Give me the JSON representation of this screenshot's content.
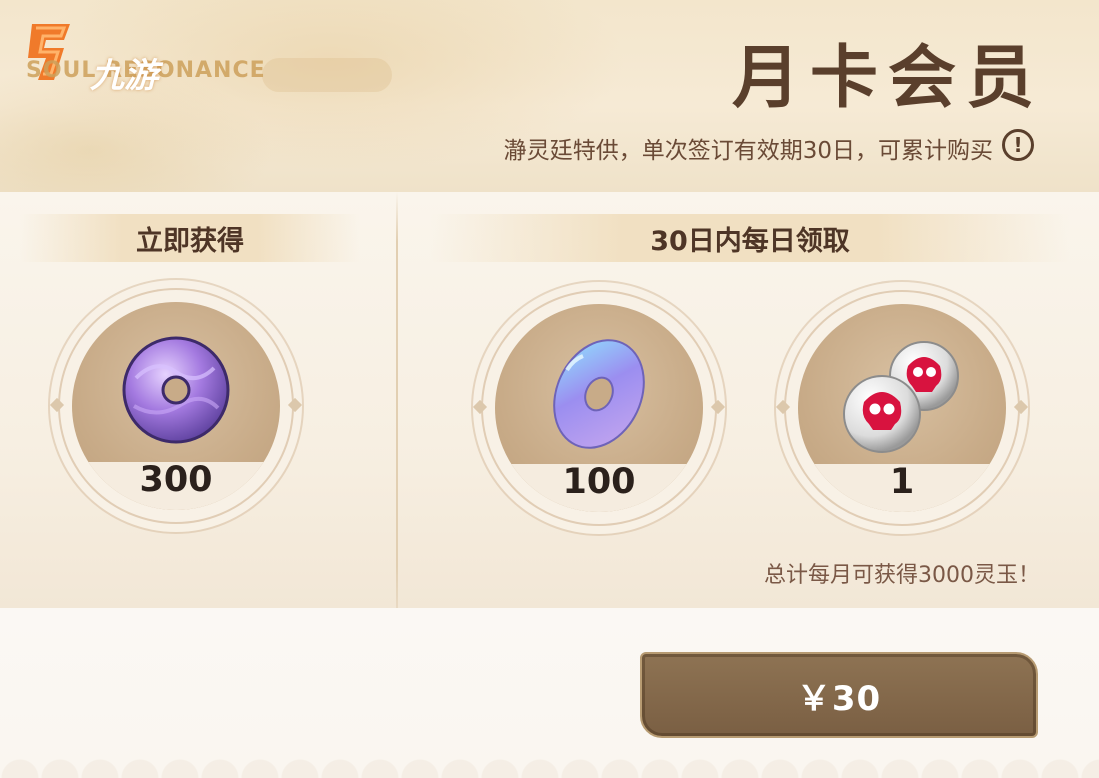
{
  "header": {
    "logo_game_name": "SOUL RESONANCE",
    "logo_watermark": "九游",
    "title": "月卡会员",
    "subtitle": "瀞灵廷特供，单次签订有效期30日，可累计购买",
    "info_icon": "info-exclamation-icon"
  },
  "left_section": {
    "heading": "立即获得",
    "items": [
      {
        "name": "灵玉",
        "icon": "purple-jade-coin-icon",
        "quantity": "300"
      }
    ]
  },
  "right_section": {
    "heading": "30日内每日领取",
    "items": [
      {
        "name": "灵玉",
        "icon": "blue-jade-coin-icon",
        "quantity": "100"
      },
      {
        "name": "skull-orbs",
        "icon": "red-skull-orb-icon",
        "quantity": "1"
      }
    ],
    "total_note": "总计每月可获得3000灵玉！"
  },
  "purchase": {
    "price_label": "￥30"
  },
  "colors": {
    "title_brown": "#5a3f2c",
    "button_brown": "#7a5f43",
    "panel_bg": "#f8f1e6"
  }
}
